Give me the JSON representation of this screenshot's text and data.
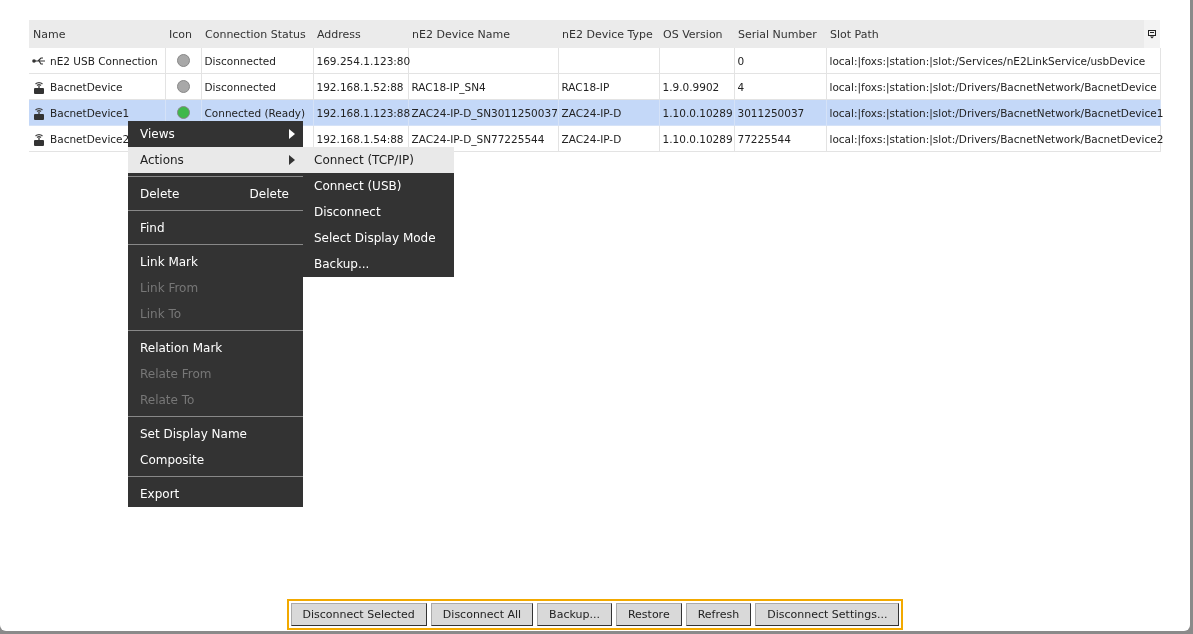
{
  "table": {
    "columns": [
      "Name",
      "Icon",
      "Connection Status",
      "Address",
      "nE2 Device Name",
      "nE2 Device Type",
      "OS Version",
      "Serial Number",
      "Slot Path"
    ],
    "rows": [
      {
        "kind": "usb",
        "name": "nE2 USB Connection",
        "color": "#a8a8a8",
        "status": "Disconnected",
        "address": "169.254.1.123:80",
        "serial": "0",
        "slot_path": "local:|foxs:|station:|slot:/Services/nE2LinkService/usbDevice",
        "selected": false
      },
      {
        "kind": "device",
        "name": "BacnetDevice",
        "color": "#a8a8a8",
        "status": "Disconnected",
        "address": "192.168.1.52:88",
        "device_name": "RAC18-IP_SN4",
        "device_type": "RAC18-IP",
        "os_version": "1.9.0.9902",
        "serial": "4",
        "slot_path": "local:|foxs:|station:|slot:/Drivers/BacnetNetwork/BacnetDevice",
        "selected": false
      },
      {
        "kind": "device",
        "name": "BacnetDevice1",
        "color": "#3fb84a",
        "status": "Connected (Ready)",
        "address": "192.168.1.123:88",
        "device_name": "ZAC24-IP-D_SN3011250037",
        "device_type": "ZAC24-IP-D",
        "os_version": "1.10.0.10289",
        "serial": "3011250037",
        "slot_path": "local:|foxs:|station:|slot:/Drivers/BacnetNetwork/BacnetDevice1",
        "selected": true
      },
      {
        "kind": "device",
        "name": "BacnetDevice2",
        "address": "192.168.1.54:88",
        "device_name": "ZAC24-IP-D_SN77225544",
        "device_type": "ZAC24-IP-D",
        "os_version": "1.10.0.10289",
        "serial": "77225544",
        "slot_path": "local:|foxs:|station:|slot:/Drivers/BacnetNetwork/BacnetDevice2",
        "selected": false
      }
    ]
  },
  "context_menu": [
    {
      "kind": "item",
      "label": "Views",
      "submenu": true,
      "disabled": false,
      "selected": false
    },
    {
      "kind": "item",
      "label": "Actions",
      "submenu": true,
      "disabled": false,
      "selected": true
    },
    {
      "kind": "separator"
    },
    {
      "kind": "item",
      "label": "Delete",
      "shortcut": "Delete",
      "submenu": false,
      "disabled": false,
      "selected": false
    },
    {
      "kind": "separator"
    },
    {
      "kind": "item",
      "label": "Find",
      "submenu": false,
      "disabled": false,
      "selected": false
    },
    {
      "kind": "separator"
    },
    {
      "kind": "item",
      "label": "Link Mark",
      "submenu": false,
      "disabled": false,
      "selected": false
    },
    {
      "kind": "item",
      "label": "Link From",
      "submenu": false,
      "disabled": true,
      "selected": false
    },
    {
      "kind": "item",
      "label": "Link To",
      "submenu": false,
      "disabled": true,
      "selected": false
    },
    {
      "kind": "separator"
    },
    {
      "kind": "item",
      "label": "Relation Mark",
      "submenu": false,
      "disabled": false,
      "selected": false
    },
    {
      "kind": "item",
      "label": "Relate From",
      "submenu": false,
      "disabled": true,
      "selected": false
    },
    {
      "kind": "item",
      "label": "Relate To",
      "submenu": false,
      "disabled": true,
      "selected": false
    },
    {
      "kind": "separator"
    },
    {
      "kind": "item",
      "label": "Set Display Name",
      "submenu": false,
      "disabled": false,
      "selected": false
    },
    {
      "kind": "item",
      "label": "Composite",
      "submenu": false,
      "disabled": false,
      "selected": false
    },
    {
      "kind": "separator"
    },
    {
      "kind": "item",
      "label": "Export",
      "submenu": false,
      "disabled": false,
      "selected": false
    }
  ],
  "actions_submenu": [
    {
      "label": "Connect (TCP/IP)",
      "selected": true
    },
    {
      "label": "Connect (USB)",
      "selected": false
    },
    {
      "label": "Disconnect",
      "selected": false
    },
    {
      "label": "Select Display Mode",
      "selected": false
    },
    {
      "label": "Backup...",
      "selected": false
    }
  ],
  "buttons": [
    "Disconnect Selected",
    "Disconnect All",
    "Backup...",
    "Restore",
    "Refresh",
    "Disconnect Settings..."
  ]
}
